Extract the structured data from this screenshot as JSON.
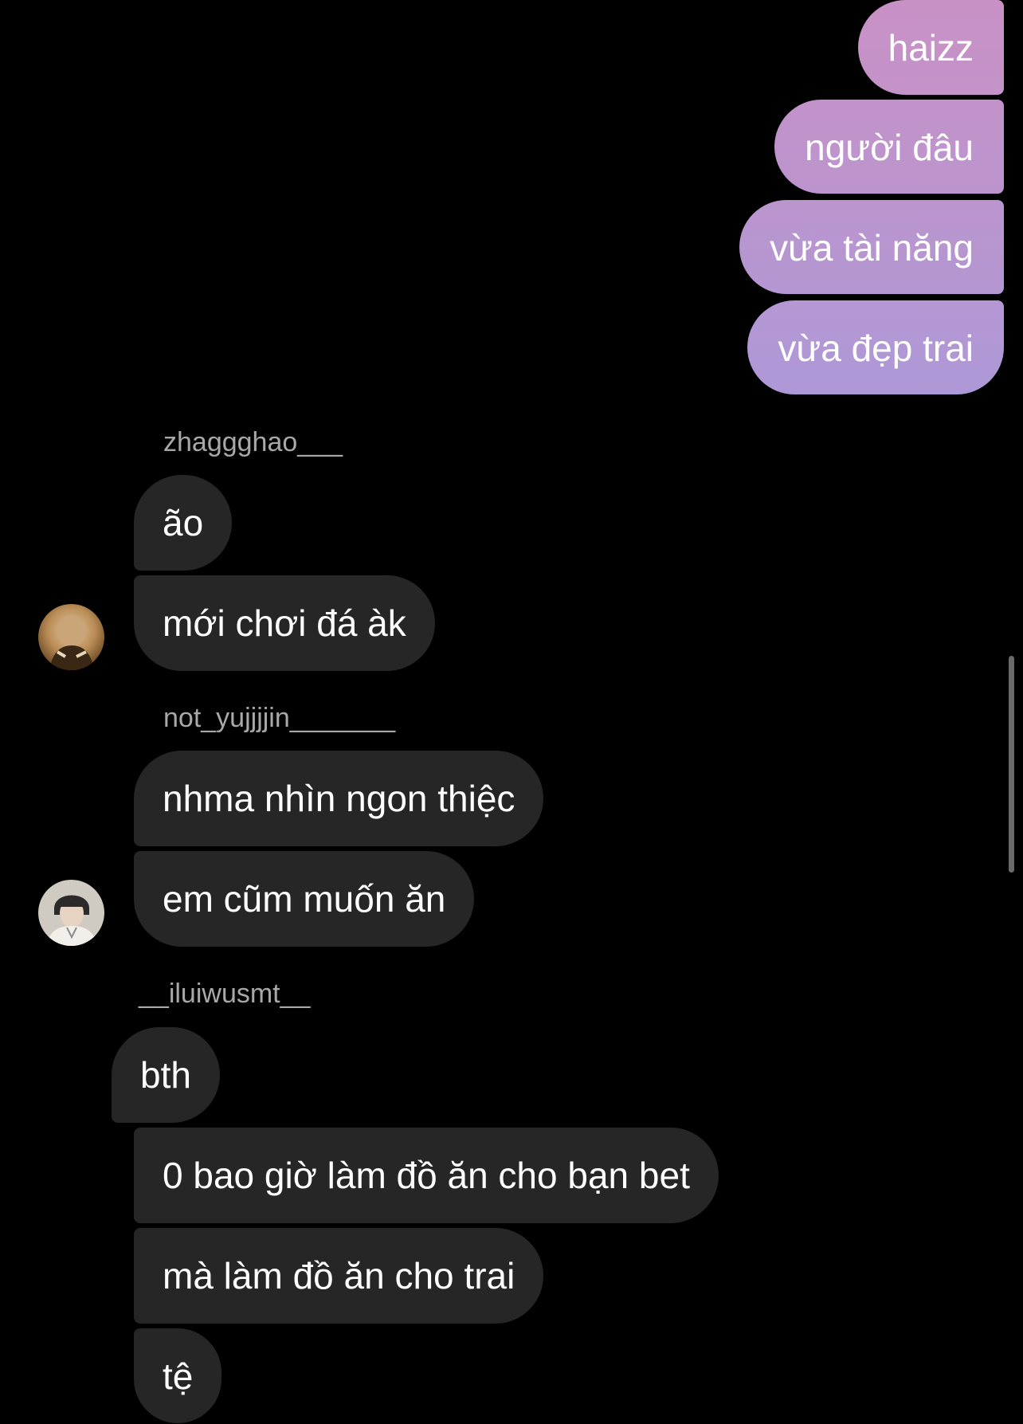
{
  "outgoing_messages": [
    {
      "text": "haizz"
    },
    {
      "text": "người đâu"
    },
    {
      "text": "vừa tài năng"
    },
    {
      "text": "vừa đẹp trai"
    }
  ],
  "groups": [
    {
      "username": "zhaggghao___",
      "avatar_icon": "profile-photo-icon",
      "messages": [
        {
          "text": "ão"
        },
        {
          "text": "mới chơi đá àk"
        }
      ]
    },
    {
      "username": "not_yujjjjin_______",
      "avatar_icon": "profile-photo-icon",
      "messages": [
        {
          "text": "nhma nhìn ngon thiệc"
        },
        {
          "text": "em cũm muốn ăn"
        }
      ]
    },
    {
      "username": "__iluiwusmt__",
      "messages": [
        {
          "text": "bth"
        },
        {
          "text": "0 bao giờ làm đồ ăn cho bạn bet"
        },
        {
          "text": "mà làm đồ ăn cho trai"
        },
        {
          "text": "tệ"
        }
      ]
    }
  ],
  "colors": {
    "background": "#000000",
    "incoming_bubble": "#262626",
    "outgoing_gradient_top": "#c48fc4",
    "outgoing_gradient_bottom": "#a68ed6",
    "username_text": "#a8a8a8"
  }
}
